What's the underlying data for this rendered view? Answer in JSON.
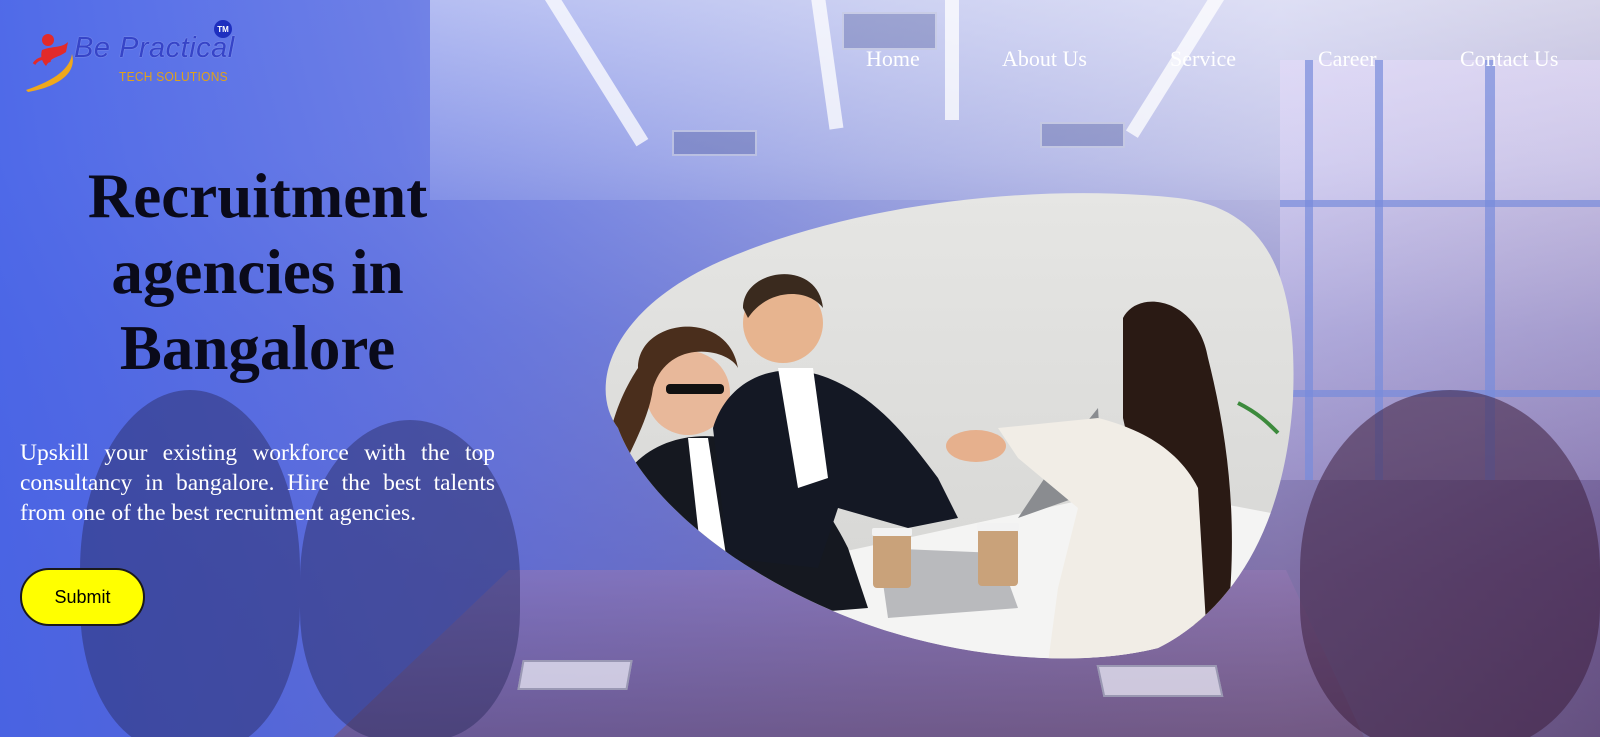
{
  "brand": {
    "name": "Be Practical",
    "tagline": "TECH SOLUTIONS",
    "trademark": "TM"
  },
  "nav": {
    "items": [
      {
        "label": "Home"
      },
      {
        "label": "About Us"
      },
      {
        "label": "Service"
      },
      {
        "label": "Career"
      },
      {
        "label": "Contact Us"
      }
    ]
  },
  "hero": {
    "title_line1": "Recruitment",
    "title_line2": "agencies in",
    "title_line3": "Bangalore",
    "subtitle": "Upskill your existing workforce with the top consultancy in bangalore. Hire the best talents from one of the best recruitment agencies.",
    "submit_label": "Submit"
  },
  "colors": {
    "nav_text": "#ffffff",
    "title": "#0a0a1a",
    "subtitle": "#ffffff",
    "button_bg": "#ffff00",
    "brand_blue": "#3644c8",
    "brand_orange": "#e0a21a",
    "overlay_blue": "#4864e8"
  },
  "icons": {
    "logo_mark": "runner-swoosh-icon"
  }
}
